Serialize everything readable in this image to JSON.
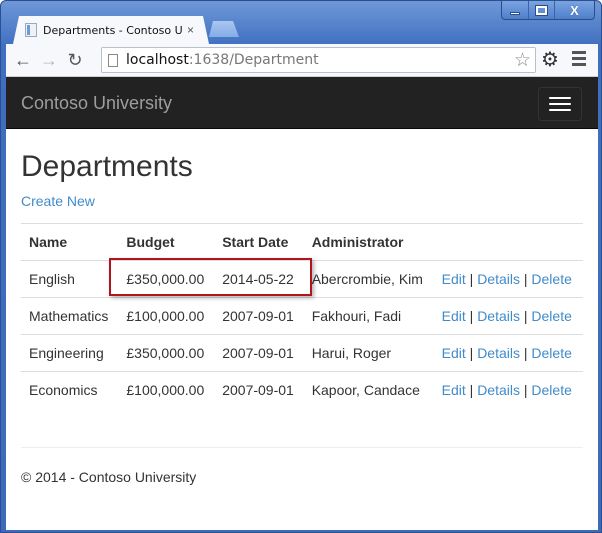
{
  "browser": {
    "tab_title": "Departments - Contoso University",
    "tab_close": "×",
    "url_host": "localhost",
    "url_rest": ":1638/Department",
    "icons": {
      "back": "back-arrow-icon",
      "forward": "forward-arrow-icon",
      "reload": "reload-icon",
      "bookmark": "star-icon",
      "settings": "gear-icon",
      "menu": "menu-icon"
    },
    "glyphs": {
      "back": "←",
      "forward": "→",
      "reload": "↻",
      "star": "☆",
      "gear": "⚙",
      "close": "X"
    }
  },
  "navbar": {
    "brand": "Contoso University"
  },
  "page": {
    "title": "Departments",
    "create_link": "Create New",
    "table": {
      "headers": [
        "Name",
        "Budget",
        "Start Date",
        "Administrator",
        ""
      ],
      "rows": [
        {
          "name": "English",
          "budget": "£350,000.00",
          "start_date": "2014-05-22",
          "administrator": "Abercrombie, Kim"
        },
        {
          "name": "Mathematics",
          "budget": "£100,000.00",
          "start_date": "2007-09-01",
          "administrator": "Fakhouri, Fadi"
        },
        {
          "name": "Engineering",
          "budget": "£350,000.00",
          "start_date": "2007-09-01",
          "administrator": "Harui, Roger"
        },
        {
          "name": "Economics",
          "budget": "£100,000.00",
          "start_date": "2007-09-01",
          "administrator": "Kapoor, Candace"
        }
      ],
      "actions": {
        "edit": "Edit",
        "details": "Details",
        "delete": "Delete",
        "separator": "|"
      }
    },
    "footer": "© 2014 - Contoso University"
  },
  "colors": {
    "link": "#428bca",
    "navbar_bg": "#222222",
    "highlight_border": "#b0141c"
  }
}
